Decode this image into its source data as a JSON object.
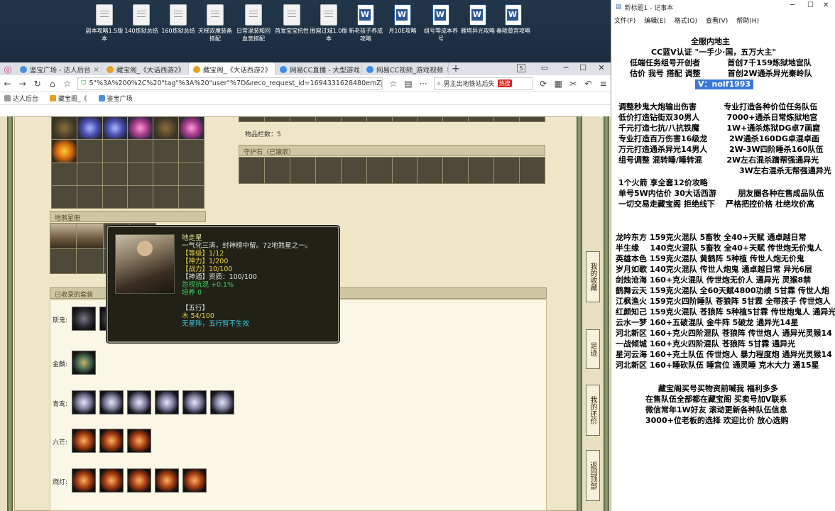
{
  "desktop_icons": [
    {
      "label": "副本攻略1.5版本",
      "type": "doc"
    },
    {
      "label": "140炼狱总结",
      "type": "doc"
    },
    {
      "label": "160炼狱总结",
      "type": "doc"
    },
    {
      "label": "天梯双魔装备搭配",
      "type": "doc"
    },
    {
      "label": "日常混装和回血宽搭配",
      "type": "doc"
    },
    {
      "label": "首发宝宝抗性",
      "type": "doc"
    },
    {
      "label": "围窟过城1.0版本",
      "type": "doc"
    },
    {
      "label": "新老孩子养成攻略",
      "type": "word"
    },
    {
      "label": "月10E攻略",
      "type": "word"
    },
    {
      "label": "组号零成本养号",
      "type": "word"
    },
    {
      "label": "雁塔异光攻略",
      "type": "word"
    },
    {
      "label": "秦陵墓宫攻略",
      "type": "word"
    }
  ],
  "browser": {
    "tabs": [
      {
        "label": "鉴宝广场 - 达人后台",
        "active": false,
        "color": "#4a90d9"
      },
      {
        "label": "藏宝阁_《大话西游2》",
        "active": false,
        "color": "#e8a020"
      },
      {
        "label": "藏宝阁_《大话西游2》",
        "active": true,
        "color": "#e8a020"
      },
      {
        "label": "网易CC直播 - 大型游戏",
        "active": false,
        "color": "#3a8ee6"
      },
      {
        "label": "网易CC视频_游戏视频",
        "active": false,
        "color": "#3a8ee6"
      }
    ],
    "tab_count": "5",
    "url": "5\"%3A%200%2C%20\"tag\"%3A%20\"user\"%7D&reco_request_id=1694331628480emZJd",
    "search_text": "男主出地铁站后失",
    "search_hot": "热搜",
    "bookmarks": [
      "达人后台",
      "藏宝阁_《",
      "鉴宝广场"
    ]
  },
  "game": {
    "item_count_label": "物品栏数：5",
    "guard_stone_title": "守护石（已镶嵌）",
    "earth_star_title": "地煞星册",
    "sets_title": "已收录的套装",
    "set_rows": [
      {
        "label": "斯鬼:"
      },
      {
        "label": "金麟:"
      },
      {
        "label": "青鸾:"
      },
      {
        "label": "六芒:"
      },
      {
        "label": "燃灯:"
      }
    ],
    "side_buttons": [
      {
        "label": "我的收藏"
      },
      {
        "label": "足迹"
      },
      {
        "label": "我的还价"
      },
      {
        "label": "返回顶部"
      }
    ]
  },
  "tooltip": {
    "name": "地走星",
    "desc": "一气化三清，封神榜中留。72地煞星之一。",
    "level": "【等级】1/12",
    "shenli": "【神力】1/200",
    "zhanli": "【战力】10/100",
    "shentong": "【神通】资质：100/100",
    "kangxing": "忽视抗混 +0.1%",
    "peiyang": "培养 0",
    "wuxing_title": "【五行】",
    "wuxing_value": "木 54/100",
    "wuxing_note": "无星阵，五行暂不生效"
  },
  "notepad": {
    "title": "新标题1 - 记事本",
    "menu": [
      "文件(F)",
      "编辑(E)",
      "格式(O)",
      "查看(V)",
      "帮助(H)"
    ],
    "lines": [
      "全服内地主",
      "CC蓝V认证 \"一手少·国，五万大主\"",
      "低端任务组号开创者          首创7千159炼狱地宫队",
      "估价 我号 搭配 调整          首创2W通杀异光秦岭队",
      "V：noif1993",
      "调整秒鬼大炮输出伤害          专业打造各种价位任务队伍",
      "低价打造钻街双30男人          7000+通杀日常炼狱地宫",
      "千元打造七抗/八抗铁魔          1W+通杀炼狱DG卓7画窟",
      "专业打造百万伤害16级龙        2W通杀160DG卓混卓画",
      "万元打造通杀异光14男人        2W-3W四阶睡杀160队伍",
      "组号调整 混转睡/睡转混         2W左右混杀蹭帮强通异光",
      "3W左右混杀无帮强通异光",
      "1个火箭 享全套12价攻略",
      "单号5W内估价 30大话西游        朋友圈各种在售成品队伍",
      "一切交易走藏宝阁 拒绝线下    严格把控价格 杜绝坎价高",
      "龙吟东方 159克火混队 5畜牧 全40+天赋 通卓越日常",
      "半生缘    140克火混队 5畜牧 全40+天赋 传世炮无价鬼人",
      "英雄本色 159克火混队 黄鹤阵 5种植 传世人炮无价鬼",
      "岁月如歌 140克火混队 传世人炮鬼 通卓越日常 异光6层",
      "剑烛沧海 160+克火混队 传世炮无价人 通异光 灵猴8禁",
      "鹤舞云天 159克火混队 全60天赋4800功绩 5甘霖 传世人炮",
      "江枫渔火 159克火四阶睡队 苍狼阵 5甘霖 全带孩子 传世炮人",
      "红颜知己 159克火混队 苍狼阵 5种植5甘霖 传世炮鬼人 通异光",
      "云水一梦 160+五破混队 金牛阵 5破龙 通异光14星",
      "河北新区 160+克火四阶混队 苍狼阵 传世炮人 通异光灵猴14",
      "一战倾城 160+克火四阶混队 苍狼阵 5甘霖 通异光",
      "星河云海 160+克土队伍 传世炮人 暴力程度炮 通异光灵猴14",
      "河北新区 160+睡砍队伍 睡宫位 通灵睡 克木大力 通15星",
      "藏宝阁买号买物资前喊我 福利多多",
      "在售队伍全部都在藏宝阁 买卖号加V联系",
      "微信常年1W好友 滚动更新各种队伍信息",
      "3000+位老板的选择 欢迎比价 放心选购"
    ]
  }
}
